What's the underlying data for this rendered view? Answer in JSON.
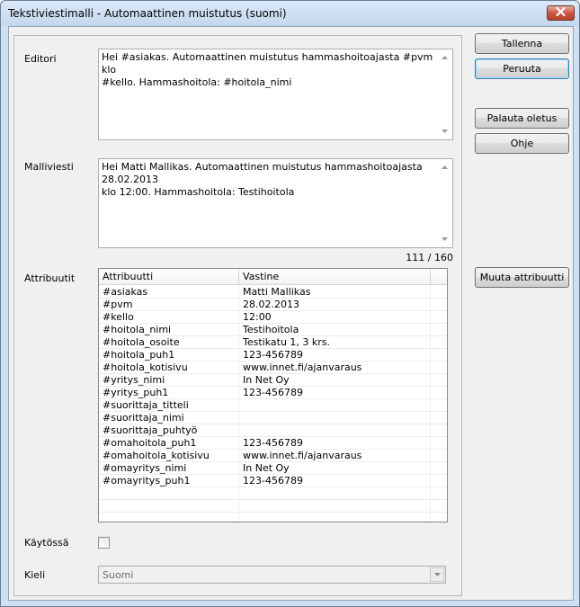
{
  "window": {
    "title": "Tekstiviestimalli - Automaattinen muistutus (suomi)",
    "close_icon": "close-icon"
  },
  "form": {
    "editor": {
      "label": "Editori",
      "text": "Hei #asiakas. Automaattinen muistutus hammashoitoajasta #pvm klo\n#kello. Hammashoitola: #hoitola_nimi"
    },
    "preview": {
      "label": "Malliviesti",
      "text": "Hei Matti Mallikas. Automaattinen muistutus hammashoitoajasta 28.02.2013\nklo 12:00. Hammashoitola: Testihoitola",
      "counter": "111 / 160"
    },
    "attributes": {
      "label": "Attribuutit",
      "columns": [
        "Attribuutti",
        "Vastine"
      ],
      "rows": [
        [
          "#asiakas",
          "Matti Mallikas"
        ],
        [
          "#pvm",
          "28.02.2013"
        ],
        [
          "#kello",
          "12:00"
        ],
        [
          "#hoitola_nimi",
          "Testihoitola"
        ],
        [
          "#hoitola_osoite",
          "Testikatu 1, 3 krs."
        ],
        [
          "#hoitola_puh1",
          "123-456789"
        ],
        [
          "#hoitola_kotisivu",
          "www.innet.fi/ajanvaraus"
        ],
        [
          "#yritys_nimi",
          "In Net Oy"
        ],
        [
          "#yritys_puh1",
          "123-456789"
        ],
        [
          "#suorittaja_titteli",
          ""
        ],
        [
          "#suorittaja_nimi",
          ""
        ],
        [
          "#suorittaja_puhtyö",
          ""
        ],
        [
          "#omahoitola_puh1",
          "123-456789"
        ],
        [
          "#omahoitola_kotisivu",
          "www.innet.fi/ajanvaraus"
        ],
        [
          "#omayritys_nimi",
          "In Net Oy"
        ],
        [
          "#omayritys_puh1",
          "123-456789"
        ]
      ]
    },
    "enabled": {
      "label": "Käytössä",
      "checked": false
    },
    "language": {
      "label": "Kieli",
      "value": "Suomi"
    }
  },
  "buttons": {
    "save": "Tallenna",
    "cancel": "Peruuta",
    "restore_default": "Palauta oletus",
    "help": "Ohje",
    "change_attribute": "Muuta attribuutti"
  }
}
